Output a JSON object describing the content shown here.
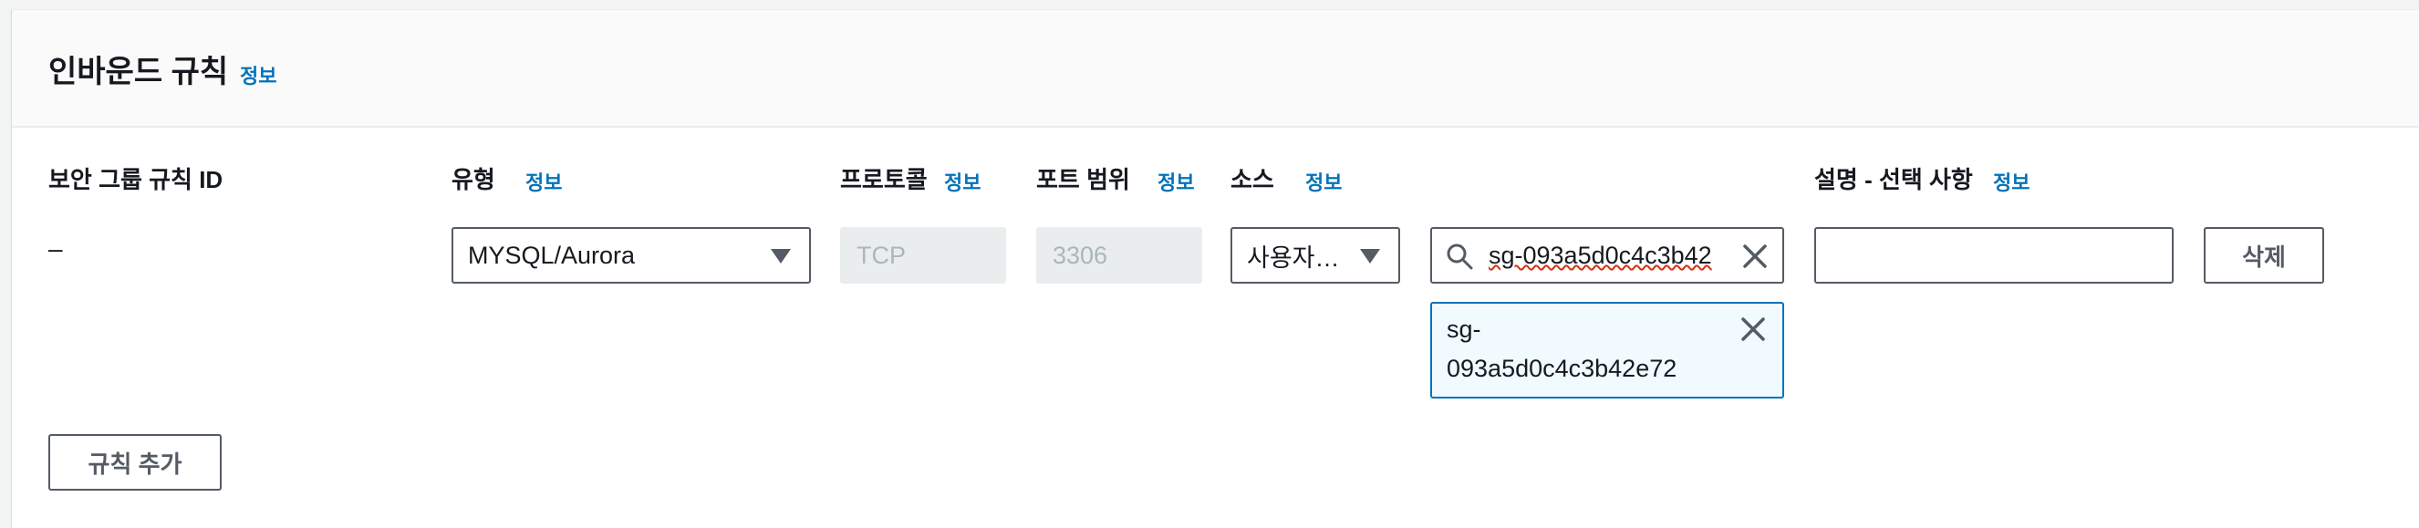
{
  "section": {
    "title": "인바운드 규칙",
    "info": "정보"
  },
  "columns": {
    "rule_id": "보안 그룹 규칙 ID",
    "type": "유형",
    "type_info": "정보",
    "protocol": "프로토콜",
    "protocol_info": "정보",
    "port_range": "포트 범위",
    "port_info": "정보",
    "source": "소스",
    "source_info": "정보",
    "description": "설명 - 선택 사항",
    "description_info": "정보"
  },
  "rule": {
    "id": "–",
    "type": "MYSQL/Aurora",
    "protocol": "TCP",
    "port": "3306",
    "source": "사용자…",
    "search_value": "sg-093a5d0c4c3b42",
    "token_line1": "sg-",
    "token_line2": "093a5d0c4c3b42e72",
    "description": "",
    "delete_label": "삭제"
  },
  "add_rule_label": "규칙 추가",
  "icons": [
    "search-icon",
    "close-icon",
    "dropdown-caret-icon"
  ],
  "colors": {
    "link": "#0073bb",
    "border": "#545b64",
    "token_bg": "#f1faff"
  }
}
